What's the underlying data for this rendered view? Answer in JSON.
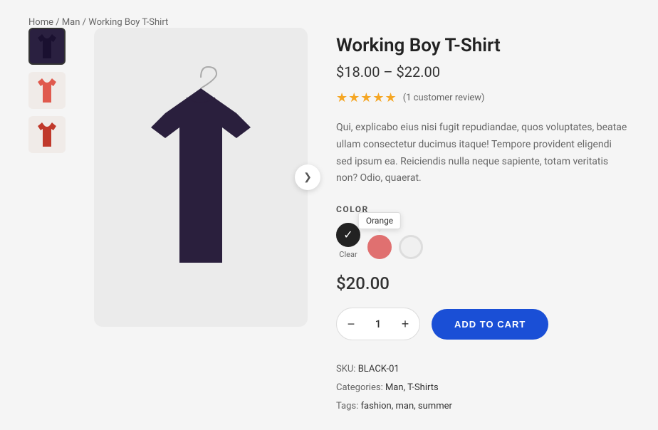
{
  "breadcrumb": {
    "items": [
      "Home",
      "Man",
      "Working Boy T-Shirt"
    ],
    "separator": "/"
  },
  "product": {
    "title": "Working Boy T-Shirt",
    "price_range": "$18.00 – $22.00",
    "selected_price": "$20.00",
    "rating": 5,
    "review_count": "(1 customer review)",
    "description": "Qui, explicabo eius nisi fugit repudiandae, quos voluptates, beatae ullam consectetur ducimus itaque! Tempore provident eligendi sed ipsum ea. Reiciendis nulla neque sapiente, totam veritatis non? Odio, quaerat.",
    "color_label": "COLOR",
    "colors": [
      {
        "name": "black",
        "label": "Clear",
        "selected": true
      },
      {
        "name": "orange",
        "label": "Orange",
        "hovered": true
      },
      {
        "name": "white",
        "label": "",
        "selected": false
      }
    ],
    "quantity": 1,
    "add_to_cart_label": "ADD TO CART",
    "sku": "BLACK-01",
    "categories": "Man, T-Shirts",
    "tags": "fashion, man, summer",
    "thumbnails": [
      {
        "label": "Black T-Shirt thumbnail",
        "color": "#2a2040"
      },
      {
        "label": "Red T-Shirt thumbnail",
        "color": "#e05a4e"
      },
      {
        "label": "Dark Red T-Shirt thumbnail",
        "color": "#c0392b"
      }
    ],
    "nav_arrow": "❯",
    "stars": "★★★★★",
    "minus_label": "−",
    "plus_label": "+"
  }
}
